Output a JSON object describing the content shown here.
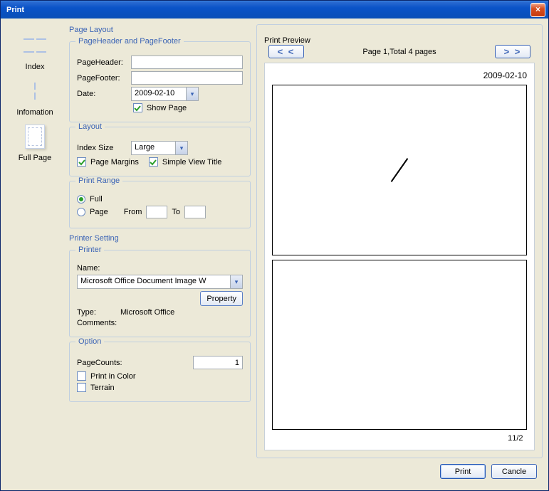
{
  "window": {
    "title": "Print"
  },
  "nav": {
    "index_label": "Index",
    "info_label": "Infomation",
    "fullpage_label": "Full Page"
  },
  "pagelayout": {
    "section_label": "Page Layout",
    "header_footer": {
      "legend": "PageHeader and PageFooter",
      "pageheader_label": "PageHeader:",
      "pageheader_value": "",
      "pagefooter_label": "PageFooter:",
      "pagefooter_value": "",
      "date_label": "Date:",
      "date_value": "2009-02-10",
      "showpage_label": "Show Page",
      "showpage_checked": true
    },
    "layout": {
      "legend": "Layout",
      "indexsize_label": "Index Size",
      "indexsize_value": "Large",
      "pagemargins_label": "Page Margins",
      "pagemargins_checked": true,
      "simpleview_label": "Simple View Title",
      "simpleview_checked": true
    },
    "printrange": {
      "legend": "Print Range",
      "full_label": "Full",
      "page_label": "Page",
      "selected": "full",
      "from_label": "From",
      "to_label": "To",
      "from_value": "",
      "to_value": ""
    }
  },
  "printersetting": {
    "section_label": "Printer Setting",
    "printer": {
      "legend": "Printer",
      "name_label": "Name:",
      "name_value": "Microsoft Office Document Image W",
      "property_button": "Property",
      "type_label": "Type:",
      "type_value": "Microsoft Office",
      "comments_label": "Comments:",
      "comments_value": ""
    },
    "option": {
      "legend": "Option",
      "pagecounts_label": "PageCounts:",
      "pagecounts_value": "1",
      "printcolor_label": "Print in Color",
      "printcolor_checked": false,
      "terrain_label": "Terrain",
      "terrain_checked": false
    }
  },
  "preview": {
    "legend": "Print Preview",
    "status": "Page 1,Total 4 pages",
    "prev_label": "< <",
    "next_label": "> >",
    "sheet": {
      "date_footer": "2009-02-10",
      "page_indicator": "1/2",
      "page_number": "1"
    }
  },
  "actions": {
    "print": "Print",
    "cancel": "Cancle"
  }
}
